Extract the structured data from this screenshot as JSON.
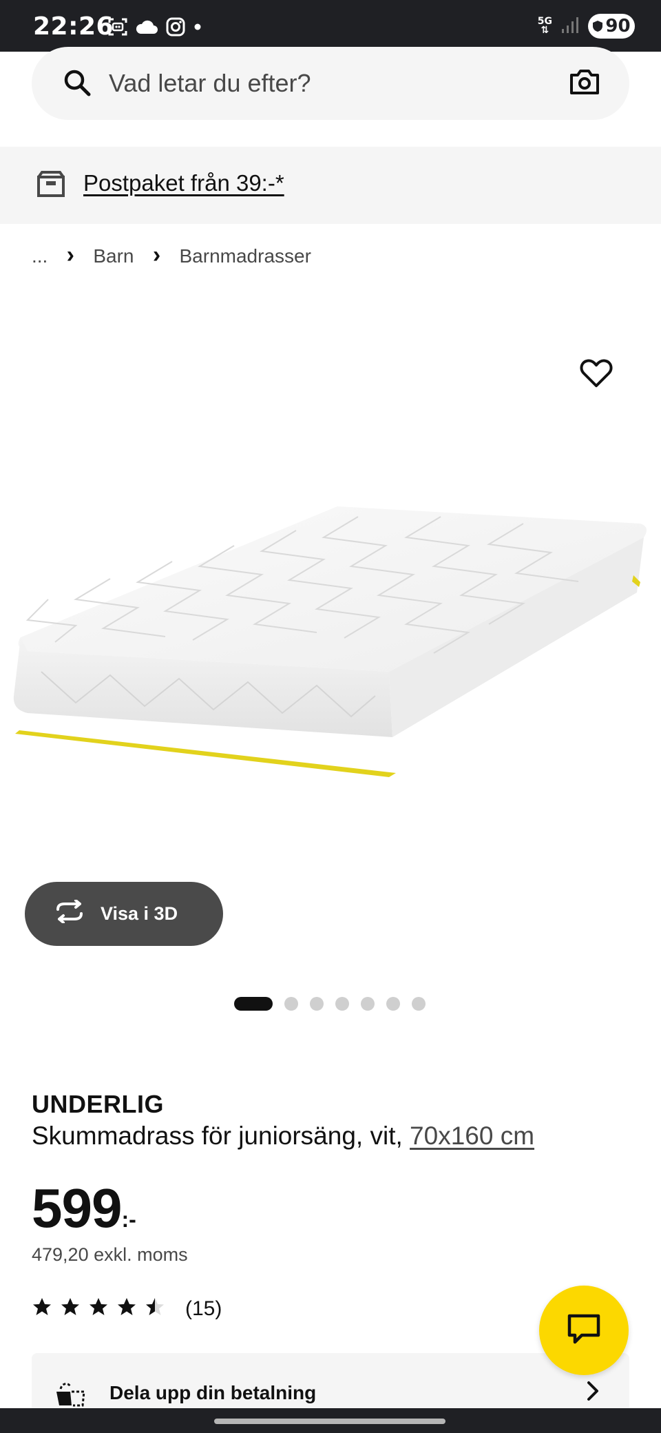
{
  "status_bar": {
    "time": "22:26",
    "network": "5G",
    "battery": "90",
    "left_icons": [
      "screen-record-icon",
      "cloud-icon",
      "instagram-icon",
      "dot-icon"
    ]
  },
  "search": {
    "placeholder": "Vad letar du efter?"
  },
  "promo": {
    "text": "Postpaket från 39:-*"
  },
  "breadcrumb": {
    "items": [
      "...",
      "Barn",
      "Barnmadrasser"
    ]
  },
  "media": {
    "view_3d_label": "Visa i 3D",
    "dot_count": 7,
    "active_dot": 0
  },
  "product": {
    "brand": "UNDERLIG",
    "description": "Skummadrass för juniorsäng, vit, ",
    "size": "70x160 cm",
    "price": "599",
    "price_suffix": ":-",
    "price_ex_vat": "479,20 exkl. moms",
    "rating": 4.5,
    "review_count": "(15)"
  },
  "payment": {
    "label": "Dela upp din betalning"
  },
  "colors": {
    "accent_yellow": "#fcd800",
    "dark": "#111111",
    "status_bar": "#1f2024",
    "surface": "#f5f5f5"
  }
}
